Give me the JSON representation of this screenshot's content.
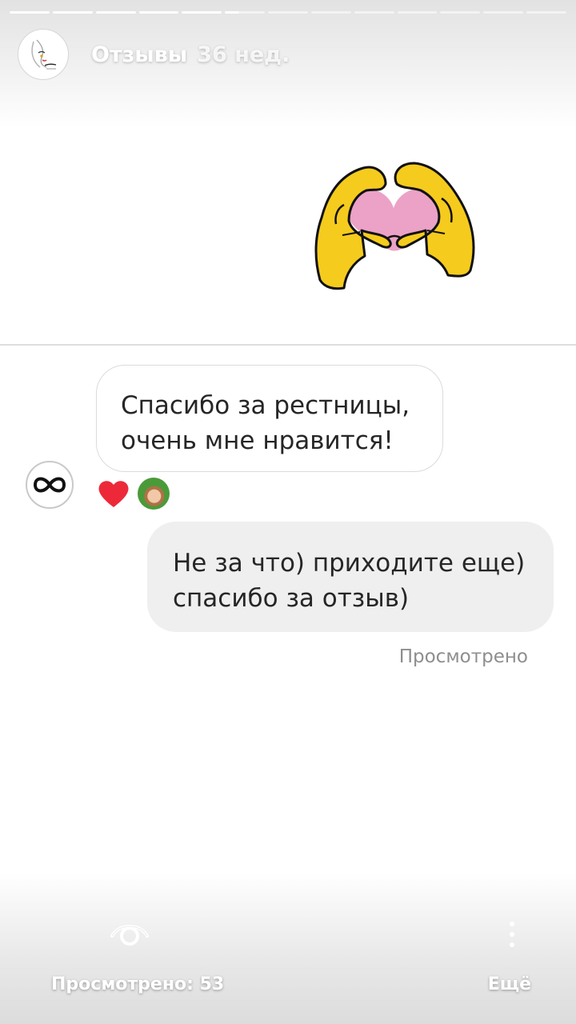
{
  "story": {
    "title": "Отзывы",
    "age": "36 нед.",
    "progress": {
      "segments": 13,
      "current": 6,
      "current_fraction": 0.35
    }
  },
  "chat": {
    "incoming_message": "Спасибо за рестницы, очень мне нравится!",
    "outgoing_message": "Не за что) приходите еще) спасибо за отзыв)",
    "seen_label": "Просмотрено",
    "reactions": [
      "heart",
      "user-avatar"
    ]
  },
  "footer": {
    "views_label": "Просмотрено: 53",
    "more_label": "Ещё"
  },
  "icons": {
    "sticker": "heart-hands-icon",
    "views": "eye-icon",
    "more": "more-vertical-icon",
    "sender": "infinity-icon"
  },
  "colors": {
    "bubble_out_bg": "#efefef",
    "heart_red": "#ed2939",
    "hands_yellow": "#f5cb1e",
    "heart_pink": "#eba2c6"
  }
}
